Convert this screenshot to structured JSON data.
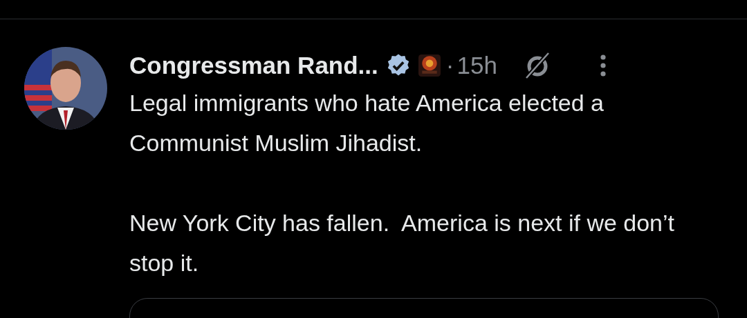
{
  "post": {
    "author": "Congressman Rand...",
    "verified": true,
    "separator": "·",
    "time": "15h",
    "paragraphs": [
      "Legal immigrants who hate America elected a Communist Muslim Jihadist.",
      "New York City has fallen.  America is next if we don’t stop it."
    ]
  }
}
